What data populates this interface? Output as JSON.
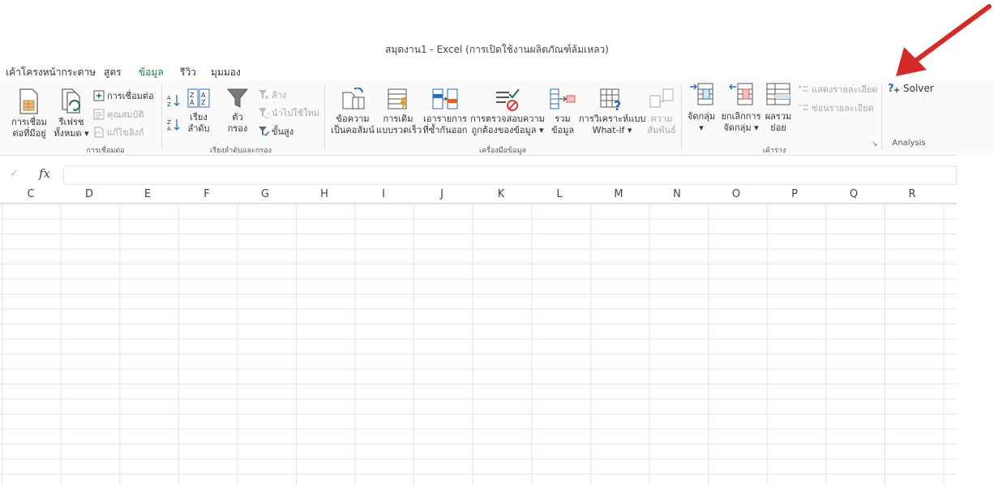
{
  "window": {
    "title": "สมุดงาน1 - Excel (การเปิดใช้งานผลิตภัณฑ์ล้มเหลว)"
  },
  "tabs": [
    {
      "label": "เค้าโครงหน้ากระดาษ"
    },
    {
      "label": "สูตร"
    },
    {
      "label": "ข้อมูล",
      "active": true
    },
    {
      "label": "รีวิว"
    },
    {
      "label": "มุมมอง"
    }
  ],
  "ribbon": {
    "existing_connections": {
      "line1": "การเชื่อม",
      "line2": "ต่อที่มีอยู่"
    },
    "refresh_all": {
      "line1": "รีเฟรช",
      "line2": "ทั้งหมด ▾"
    },
    "connections": "การเชื่อมต่อ",
    "properties": "คุณสมบัติ",
    "edit_links": "แก้ไขลิงก์",
    "group_connections": "การเชื่อมต่อ",
    "sort": {
      "line1": "เรียง",
      "line2": "ลำดับ"
    },
    "filter": {
      "line1": "ตัว",
      "line2": "กรอง"
    },
    "clear": "ล้าง",
    "reapply": "นำไปใช้ใหม่",
    "advanced": "ขั้นสูง",
    "group_sort_filter": "เรียงลำดับและกรอง",
    "text_to_columns": {
      "line1": "ข้อความ",
      "line2": "เป็นคอลัมน์"
    },
    "flash_fill": {
      "line1": "การเติม",
      "line2": "แบบรวดเร็ว"
    },
    "remove_duplicates": {
      "line1": "เอารายการ",
      "line2": "ที่ซ้ำกันออก"
    },
    "data_validation": {
      "line1": "การตรวจสอบความ",
      "line2": "ถูกต้องของข้อมูล ▾"
    },
    "consolidate": {
      "line1": "รวม",
      "line2": "ข้อมูล"
    },
    "what_if": {
      "line1": "การวิเคราะห์แบบ",
      "line2": "What-if ▾"
    },
    "relationships": {
      "line1": "ความ",
      "line2": "สัมพันธ์"
    },
    "group_data_tools": "เครื่องมือข้อมูล",
    "group": {
      "line1": "จัดกลุ่ม",
      "line2": "▾"
    },
    "ungroup": {
      "line1": "ยกเลิกการ",
      "line2": "จัดกลุ่ม ▾"
    },
    "subtotal": {
      "line1": "ผลรวม",
      "line2": "ย่อย"
    },
    "show_detail": "แสดงรายละเอียด",
    "hide_detail": "ซ่อนรายละเอียด",
    "group_outline": "เค้าร่าง",
    "solver": "Solver",
    "group_analysis": "Analysis"
  },
  "formula_bar": {
    "fx": "fx",
    "check": "✓"
  },
  "columns": [
    "C",
    "D",
    "E",
    "F",
    "G",
    "H",
    "I",
    "J",
    "K",
    "L",
    "M",
    "N",
    "O",
    "P",
    "Q",
    "R"
  ],
  "colors": {
    "accent": "#217346",
    "arrow": "#d42a2a"
  },
  "icons": [
    "check-icon",
    "fx-icon",
    "solver-icon",
    "filter-icon",
    "sort-icon",
    "arrow-pointer-icon"
  ]
}
